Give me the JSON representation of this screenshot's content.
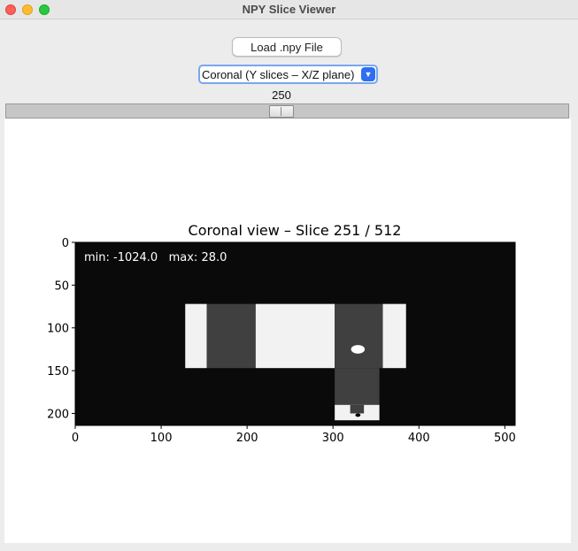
{
  "window": {
    "title": "NPY Slice Viewer"
  },
  "toolbar": {
    "load_label": "Load .npy File",
    "view_select_value": "Coronal (Y slices – X/Z plane)"
  },
  "slider": {
    "value_label": "250",
    "value": 250,
    "max": 511
  },
  "plot": {
    "title": "Coronal view – Slice 251 / 512",
    "overlay_text": "min: -1024.0   max: 28.0",
    "x_ticks": [
      "0",
      "100",
      "200",
      "300",
      "400",
      "500"
    ],
    "y_ticks": [
      "0",
      "50",
      "100",
      "150",
      "200"
    ]
  },
  "chart_data": {
    "type": "heatmap",
    "title": "Coronal view – Slice 251 / 512",
    "xlim": [
      0,
      512
    ],
    "ylim": [
      214,
      0
    ],
    "x_ticks": [
      0,
      100,
      200,
      300,
      400,
      500
    ],
    "y_ticks": [
      0,
      50,
      100,
      150,
      200
    ],
    "value_range": [
      -1024.0,
      28.0
    ],
    "colormap": "gray",
    "regions": [
      {
        "shape": "rect",
        "x0": 0,
        "x1": 512,
        "y0": 0,
        "y1": 214,
        "intensity": 0.04
      },
      {
        "shape": "rect",
        "x0": 128,
        "x1": 153,
        "y0": 72,
        "y1": 147,
        "intensity": 0.95
      },
      {
        "shape": "rect",
        "x0": 153,
        "x1": 210,
        "y0": 72,
        "y1": 147,
        "intensity": 0.25
      },
      {
        "shape": "rect",
        "x0": 210,
        "x1": 302,
        "y0": 72,
        "y1": 147,
        "intensity": 0.95
      },
      {
        "shape": "rect",
        "x0": 302,
        "x1": 358,
        "y0": 72,
        "y1": 147,
        "intensity": 0.25
      },
      {
        "shape": "rect",
        "x0": 358,
        "x1": 385,
        "y0": 72,
        "y1": 147,
        "intensity": 0.95
      },
      {
        "shape": "rect",
        "x0": 302,
        "x1": 354,
        "y0": 147,
        "y1": 190,
        "intensity": 0.25
      },
      {
        "shape": "rect",
        "x0": 302,
        "x1": 354,
        "y0": 190,
        "y1": 208,
        "intensity": 0.95
      },
      {
        "shape": "rect",
        "x0": 320,
        "x1": 336,
        "y0": 190,
        "y1": 200,
        "intensity": 0.25
      },
      {
        "shape": "ellipse",
        "cx": 329,
        "cy": 125,
        "rx": 8,
        "ry": 5,
        "intensity": 1.0
      },
      {
        "shape": "ellipse",
        "cx": 329,
        "cy": 202,
        "rx": 3,
        "ry": 2,
        "intensity": 0.0
      }
    ]
  }
}
